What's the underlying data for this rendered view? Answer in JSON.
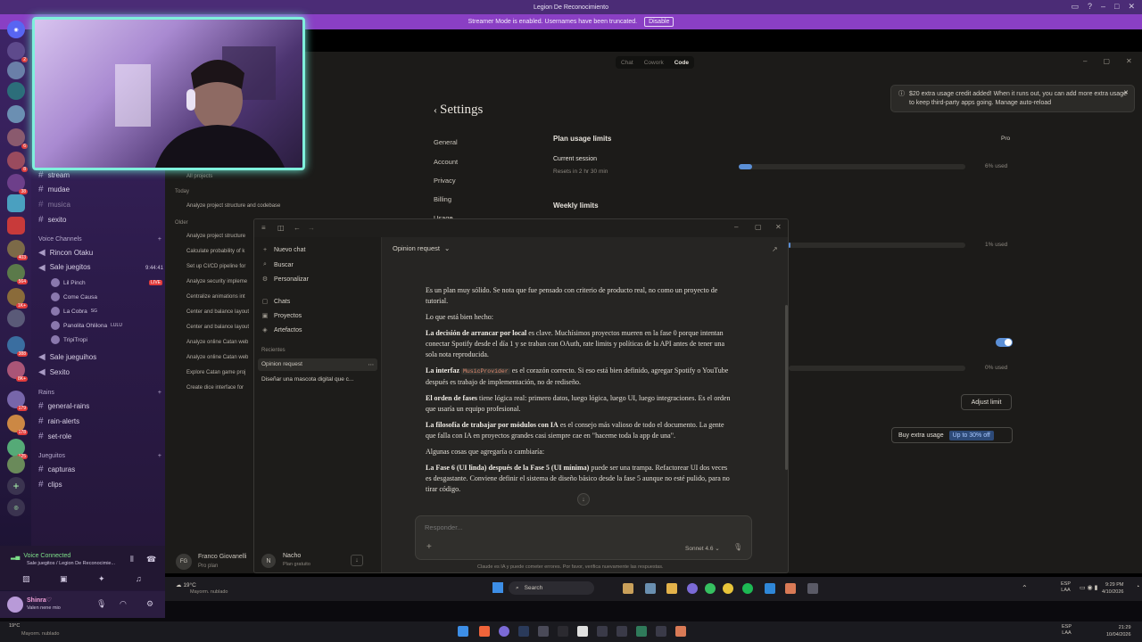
{
  "window_title": "Legion De Reconocimiento",
  "streamer": {
    "text": "Streamer Mode is enabled. Usernames have been truncated.",
    "button": "Disable"
  },
  "discord": {
    "channels_top": [
      {
        "label": "stream"
      },
      {
        "label": "mudae"
      },
      {
        "label": "musica"
      },
      {
        "label": "sexito"
      }
    ],
    "voice_section": "Voice Channels",
    "voice_channels": [
      {
        "label": "Rincon Otaku"
      },
      {
        "label": "Sale juegitos",
        "time": "9:44:41"
      }
    ],
    "voice_users": [
      {
        "name": "Lil Pinch",
        "badge": "LIVE"
      },
      {
        "name": "Come Causa"
      },
      {
        "name": "La Cobra",
        "badge": "SG"
      },
      {
        "name": "Panolita Ohlilona",
        "badge": "LULU"
      },
      {
        "name": "TripiTropi"
      }
    ],
    "voice_channels_2": [
      {
        "label": "Sale jueguihos"
      },
      {
        "label": "Sexito"
      }
    ],
    "rains_section": "Rains",
    "rains_channels": [
      {
        "label": "general-rains"
      },
      {
        "label": "rain-alerts"
      },
      {
        "label": "set-role"
      }
    ],
    "jueguitos_section": "Jueguitos",
    "jueguitos_channels": [
      {
        "label": "capturas"
      },
      {
        "label": "clips"
      }
    ],
    "voice_connected": "Voice Connected",
    "voice_connected_sub": "Sale juegitos / Legion De Reconocimie...",
    "user_name": "Shinra♡",
    "user_status": "Valen nene mio",
    "guild_badges": [
      "2",
      "6",
      "8",
      "10",
      "38",
      "403",
      "564",
      "1K+",
      "388",
      "8K+",
      "179",
      "178",
      "125"
    ]
  },
  "claude": {
    "modes": {
      "chat": "Chat",
      "cowork": "Cowork",
      "code": "Code"
    },
    "settings_title": "Settings",
    "settings_nav": [
      "General",
      "Account",
      "Privacy",
      "Billing",
      "Usage"
    ],
    "notification": "$20 extra usage credit added! When it runs out, you can add more extra usage to keep third-party apps going. Manage auto-reload",
    "plan_usage_title": "Plan usage limits",
    "plan": "Pro",
    "current_session": "Current session",
    "session_reset": "Resets in 2 hr 30 min",
    "session_used": "6% used",
    "session_progress": 0.06,
    "weekly_title": "Weekly limits",
    "weekly_used": "1% used",
    "weekly_progress": 0.01,
    "extra_used": "0% used",
    "adjust_limit": "Adjust limit",
    "buy_extra": "Buy extra usage",
    "buy_extra_tag": "Up to 30% off",
    "project_filter": "All projects",
    "today_label": "Today",
    "older_label": "Older",
    "old_chats": [
      "Analyze project structure and codebase",
      "Analyze project structure",
      "Calculate probability of k",
      "Set up CI/CD pipeline for",
      "Analyze security impleme",
      "Centralize animations int",
      "Center and balance layout",
      "Center and balance layout",
      "Analyze online Catan web",
      "Analyze online Catan web",
      "Explore Catan game proj",
      "Create dice interface for"
    ],
    "footer_user": "Franco Giovanelli",
    "footer_plan": "Pro plan"
  },
  "chat_window": {
    "title": "Opinion request",
    "side_items": [
      {
        "icon": "+",
        "label": "Nuevo chat"
      },
      {
        "icon": "⌕",
        "label": "Buscar"
      },
      {
        "icon": "⚙",
        "label": "Personalizar"
      },
      {
        "icon": "▢",
        "label": "Chats"
      },
      {
        "icon": "▣",
        "label": "Proyectos"
      },
      {
        "icon": "◈",
        "label": "Artefactos"
      }
    ],
    "recent_label": "Recientes",
    "recent_items": [
      "Opinion request",
      "Diseñar una mascota digital que c..."
    ],
    "user_name": "Nacho",
    "user_plan": "Plan gratuito",
    "message": {
      "p1": "Es un plan muy sólido. Se nota que fue pensado con criterio de producto real, no como un proyecto de tutorial.",
      "p2": "Lo que está bien hecho:",
      "p3_bold": "La decisión de arrancar por local",
      "p3": " es clave. Muchísimos proyectos mueren en la fase 0 porque intentan conectar Spotify desde el día 1 y se traban con OAuth, rate limits y políticas de la API antes de tener una sola nota reproducida.",
      "p4_bold": "La interfaz",
      "p4_code": "MusicProvider",
      "p4": " es el corazón correcto. Si eso está bien definido, agregar Spotify o YouTube después es trabajo de implementación, no de rediseño.",
      "p5_bold": "El orden de fases",
      "p5": " tiene lógica real: primero datos, luego lógica, luego UI, luego integraciones. Es el orden que usaría un equipo profesional.",
      "p6_bold": "La filosofía de trabajar por módulos con IA",
      "p6": " es el consejo más valioso de todo el documento. La gente que falla con IA en proyectos grandes casi siempre cae en \"haceme toda la app de una\".",
      "p7": "Algunas cosas que agregaría o cambiaría:",
      "p8_bold": "La Fase 6 (UI linda) después de la Fase 5 (UI mínima)",
      "p8": " puede ser una trampa. Refactorear UI dos veces es desgastante. Conviene definir el sistema de diseño básico desde la fase 5 aunque no esté pulido, para no tirar código."
    },
    "input_placeholder": "Responder...",
    "model": "Sonnet 4.6",
    "disclaimer": "Claude es IA y puede cometer errores. Por favor, verifica nuevamente las respuestas."
  },
  "taskbar": {
    "search": "Search",
    "weather_temp": "19°C",
    "weather_desc": "Mayorm. nublado",
    "lang": "ESP",
    "lang2": "LAA",
    "time": "9:29 PM",
    "date": "4/10/2026",
    "time2": "21:29",
    "date2": "10/04/2026"
  }
}
